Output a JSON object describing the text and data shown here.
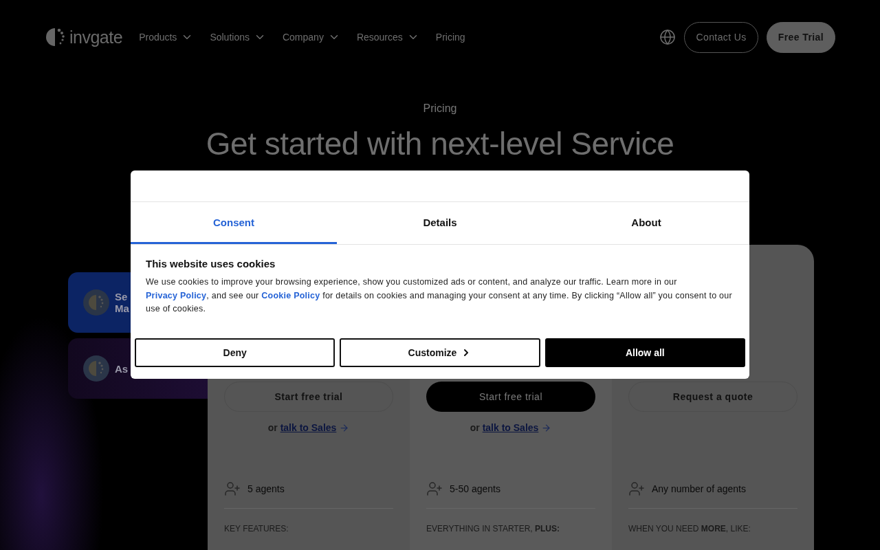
{
  "header": {
    "logo": "invgate",
    "nav": [
      {
        "label": "Products",
        "dropdown": true
      },
      {
        "label": "Solutions",
        "dropdown": true
      },
      {
        "label": "Company",
        "dropdown": true
      },
      {
        "label": "Resources",
        "dropdown": true
      },
      {
        "label": "Pricing",
        "dropdown": false
      }
    ],
    "buttons": [
      {
        "label": "Contact Us",
        "kind": "outline"
      },
      {
        "label": "Free Trial",
        "kind": "filled"
      }
    ]
  },
  "hero": {
    "eyebrow": "Pricing",
    "title": "Get started with next-level Service"
  },
  "side_tabs": [
    {
      "line1": "Se",
      "line2": "Ma",
      "selected": true
    },
    {
      "line1": "As",
      "selected": false
    }
  ],
  "plans": [
    {
      "button": {
        "label": "Start free trial",
        "kind": "outline"
      },
      "sales": {
        "prefix": "or",
        "link": "talk to Sales"
      },
      "agents": "5 agents",
      "features_heading": "KEY FEATURES:"
    },
    {
      "button": {
        "label": "Start free trial",
        "kind": "filled"
      },
      "sales": {
        "prefix": "or",
        "link": "talk to Sales"
      },
      "agents": "5-50 agents",
      "features_heading": "EVERYTHING IN STARTER, **PLUS:**"
    },
    {
      "button": {
        "label": "Request a quote",
        "kind": "outline"
      },
      "agents": "Any number of agents",
      "features_heading": "WHEN YOU NEED **MORE**, LIKE:"
    }
  ],
  "cookie_dialog": {
    "tabs": [
      {
        "label": "Consent",
        "selected": true
      },
      {
        "label": "Details",
        "selected": false
      },
      {
        "label": "About",
        "selected": false
      }
    ],
    "title": "This website uses cookies",
    "body": {
      "before": "We use cookies to improve your browsing experience, show you customized ads or content, and analyze our traffic. Learn more in our ",
      "link1": "Privacy Policy",
      "middle": ", and see our ",
      "link2": "Cookie Policy",
      "after": " for details on cookies and managing your consent at any time. By clicking “Allow all” you consent to our use of cookies."
    },
    "buttons": [
      {
        "label": "Deny",
        "kind": "outline",
        "chevron": false
      },
      {
        "label": "Customize",
        "kind": "outline",
        "chevron": true
      },
      {
        "label": "Allow all",
        "kind": "filled",
        "chevron": false
      }
    ]
  }
}
